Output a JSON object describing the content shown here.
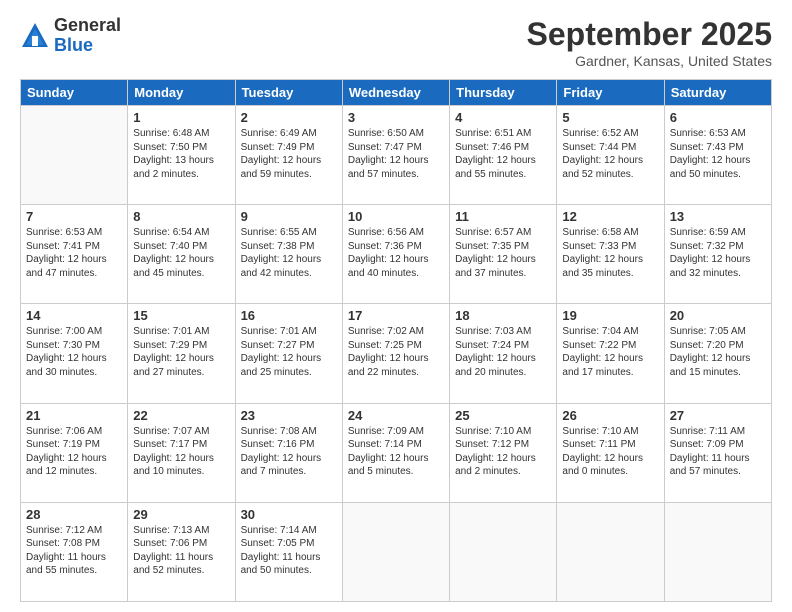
{
  "logo": {
    "general": "General",
    "blue": "Blue"
  },
  "header": {
    "title": "September 2025",
    "location": "Gardner, Kansas, United States"
  },
  "days_of_week": [
    "Sunday",
    "Monday",
    "Tuesday",
    "Wednesday",
    "Thursday",
    "Friday",
    "Saturday"
  ],
  "weeks": [
    [
      {
        "day": "",
        "info": ""
      },
      {
        "day": "1",
        "info": "Sunrise: 6:48 AM\nSunset: 7:50 PM\nDaylight: 13 hours\nand 2 minutes."
      },
      {
        "day": "2",
        "info": "Sunrise: 6:49 AM\nSunset: 7:49 PM\nDaylight: 12 hours\nand 59 minutes."
      },
      {
        "day": "3",
        "info": "Sunrise: 6:50 AM\nSunset: 7:47 PM\nDaylight: 12 hours\nand 57 minutes."
      },
      {
        "day": "4",
        "info": "Sunrise: 6:51 AM\nSunset: 7:46 PM\nDaylight: 12 hours\nand 55 minutes."
      },
      {
        "day": "5",
        "info": "Sunrise: 6:52 AM\nSunset: 7:44 PM\nDaylight: 12 hours\nand 52 minutes."
      },
      {
        "day": "6",
        "info": "Sunrise: 6:53 AM\nSunset: 7:43 PM\nDaylight: 12 hours\nand 50 minutes."
      }
    ],
    [
      {
        "day": "7",
        "info": "Sunrise: 6:53 AM\nSunset: 7:41 PM\nDaylight: 12 hours\nand 47 minutes."
      },
      {
        "day": "8",
        "info": "Sunrise: 6:54 AM\nSunset: 7:40 PM\nDaylight: 12 hours\nand 45 minutes."
      },
      {
        "day": "9",
        "info": "Sunrise: 6:55 AM\nSunset: 7:38 PM\nDaylight: 12 hours\nand 42 minutes."
      },
      {
        "day": "10",
        "info": "Sunrise: 6:56 AM\nSunset: 7:36 PM\nDaylight: 12 hours\nand 40 minutes."
      },
      {
        "day": "11",
        "info": "Sunrise: 6:57 AM\nSunset: 7:35 PM\nDaylight: 12 hours\nand 37 minutes."
      },
      {
        "day": "12",
        "info": "Sunrise: 6:58 AM\nSunset: 7:33 PM\nDaylight: 12 hours\nand 35 minutes."
      },
      {
        "day": "13",
        "info": "Sunrise: 6:59 AM\nSunset: 7:32 PM\nDaylight: 12 hours\nand 32 minutes."
      }
    ],
    [
      {
        "day": "14",
        "info": "Sunrise: 7:00 AM\nSunset: 7:30 PM\nDaylight: 12 hours\nand 30 minutes."
      },
      {
        "day": "15",
        "info": "Sunrise: 7:01 AM\nSunset: 7:29 PM\nDaylight: 12 hours\nand 27 minutes."
      },
      {
        "day": "16",
        "info": "Sunrise: 7:01 AM\nSunset: 7:27 PM\nDaylight: 12 hours\nand 25 minutes."
      },
      {
        "day": "17",
        "info": "Sunrise: 7:02 AM\nSunset: 7:25 PM\nDaylight: 12 hours\nand 22 minutes."
      },
      {
        "day": "18",
        "info": "Sunrise: 7:03 AM\nSunset: 7:24 PM\nDaylight: 12 hours\nand 20 minutes."
      },
      {
        "day": "19",
        "info": "Sunrise: 7:04 AM\nSunset: 7:22 PM\nDaylight: 12 hours\nand 17 minutes."
      },
      {
        "day": "20",
        "info": "Sunrise: 7:05 AM\nSunset: 7:20 PM\nDaylight: 12 hours\nand 15 minutes."
      }
    ],
    [
      {
        "day": "21",
        "info": "Sunrise: 7:06 AM\nSunset: 7:19 PM\nDaylight: 12 hours\nand 12 minutes."
      },
      {
        "day": "22",
        "info": "Sunrise: 7:07 AM\nSunset: 7:17 PM\nDaylight: 12 hours\nand 10 minutes."
      },
      {
        "day": "23",
        "info": "Sunrise: 7:08 AM\nSunset: 7:16 PM\nDaylight: 12 hours\nand 7 minutes."
      },
      {
        "day": "24",
        "info": "Sunrise: 7:09 AM\nSunset: 7:14 PM\nDaylight: 12 hours\nand 5 minutes."
      },
      {
        "day": "25",
        "info": "Sunrise: 7:10 AM\nSunset: 7:12 PM\nDaylight: 12 hours\nand 2 minutes."
      },
      {
        "day": "26",
        "info": "Sunrise: 7:10 AM\nSunset: 7:11 PM\nDaylight: 12 hours\nand 0 minutes."
      },
      {
        "day": "27",
        "info": "Sunrise: 7:11 AM\nSunset: 7:09 PM\nDaylight: 11 hours\nand 57 minutes."
      }
    ],
    [
      {
        "day": "28",
        "info": "Sunrise: 7:12 AM\nSunset: 7:08 PM\nDaylight: 11 hours\nand 55 minutes."
      },
      {
        "day": "29",
        "info": "Sunrise: 7:13 AM\nSunset: 7:06 PM\nDaylight: 11 hours\nand 52 minutes."
      },
      {
        "day": "30",
        "info": "Sunrise: 7:14 AM\nSunset: 7:05 PM\nDaylight: 11 hours\nand 50 minutes."
      },
      {
        "day": "",
        "info": ""
      },
      {
        "day": "",
        "info": ""
      },
      {
        "day": "",
        "info": ""
      },
      {
        "day": "",
        "info": ""
      }
    ]
  ]
}
